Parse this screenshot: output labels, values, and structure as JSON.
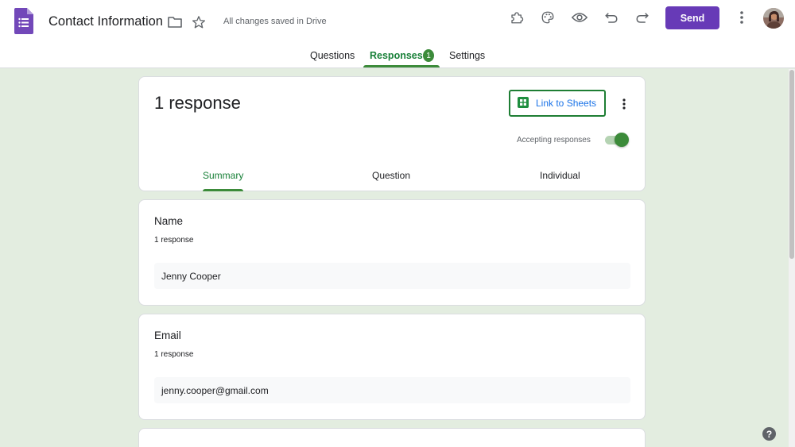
{
  "header": {
    "doc_title": "Contact Information",
    "save_status": "All changes saved in Drive",
    "send_label": "Send",
    "icons": [
      "google-forms-icon",
      "folder-icon",
      "star-icon",
      "add-ons-icon",
      "palette-icon",
      "preview-eye-icon",
      "undo-icon",
      "redo-icon",
      "more-vert-icon",
      "avatar"
    ]
  },
  "tabs": {
    "questions": "Questions",
    "responses": "Responses",
    "responses_badge": "1",
    "settings": "Settings"
  },
  "summary": {
    "title": "1 response",
    "link_sheets": "Link to Sheets",
    "accepting": "Accepting responses",
    "accepting_on": true,
    "subtabs": [
      "Summary",
      "Question",
      "Individual"
    ],
    "active_subtab": "Summary"
  },
  "questions": [
    {
      "title": "Name",
      "count": "1 response",
      "answer": "Jenny Cooper"
    },
    {
      "title": "Email",
      "count": "1 response",
      "answer": "jenny.cooper@gmail.com"
    }
  ],
  "colors": {
    "accent_purple": "#673ab7",
    "accent_green": "#3c8b3a",
    "link_blue": "#1a73e8",
    "background": "#e3ede0"
  },
  "help": "?"
}
